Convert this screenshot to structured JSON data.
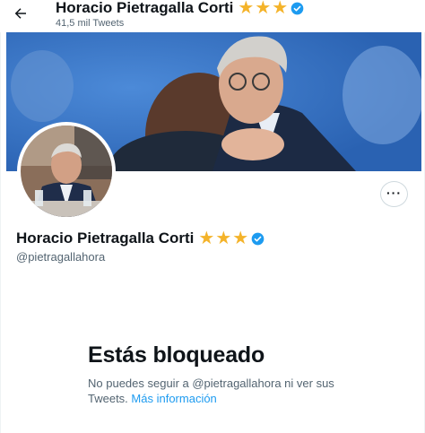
{
  "header": {
    "name": "Horacio Pietragalla Corti",
    "tweets_count": "41,5 mil Tweets"
  },
  "profile": {
    "name": "Horacio Pietragalla Corti",
    "handle": "@pietragallahora",
    "stars": 3
  },
  "icons": {
    "back": "arrow-left-icon",
    "verified": "verified-badge-icon",
    "more": "more-options-icon"
  },
  "colors": {
    "accent": "#1d9bf0",
    "star": "#f4b32a",
    "secondary_text": "#536471"
  },
  "blocked": {
    "title": "Estás bloqueado",
    "message": "No puedes seguir a @pietragallahora ni ver sus Tweets.",
    "link": "Más información"
  }
}
